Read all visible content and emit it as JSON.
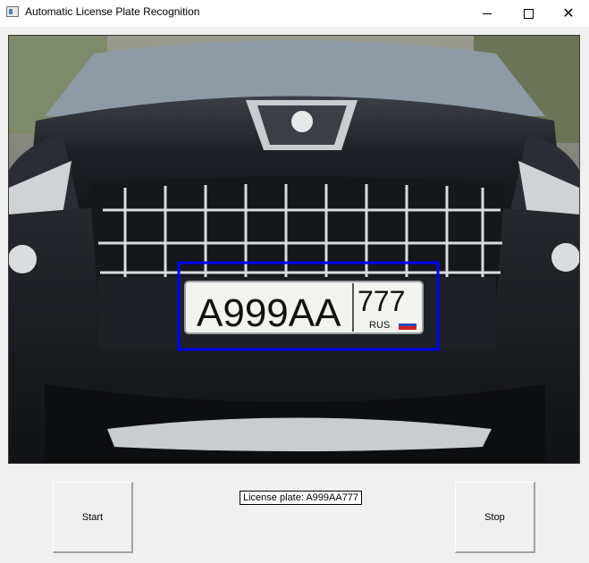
{
  "window": {
    "title": "Automatic License Plate Recognition",
    "icon": "app-icon"
  },
  "controls": {
    "minimize": "minimize-icon",
    "maximize": "maximize-icon",
    "close_glyph": "✕"
  },
  "photo": {
    "plate_main": "A999AA",
    "plate_region": "777",
    "plate_country": "RUS",
    "detection_color": "#0000ff"
  },
  "buttons": {
    "start": "Start",
    "stop": "Stop"
  },
  "result": {
    "text": "License plate: A999AA777"
  }
}
